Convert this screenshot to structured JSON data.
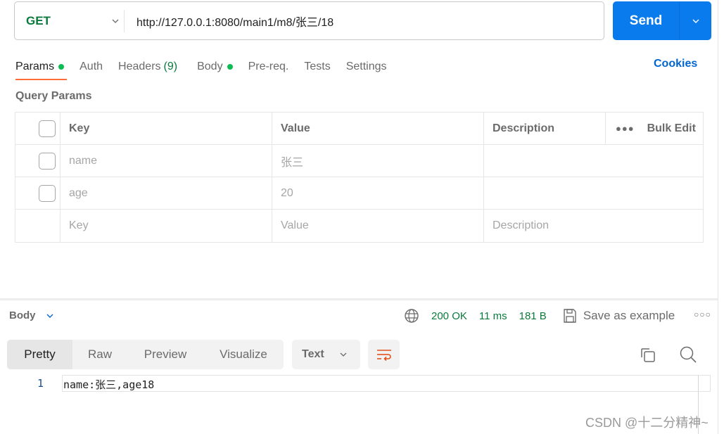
{
  "request": {
    "method": "GET",
    "url": "http://127.0.0.1:8080/main1/m8/张三/18",
    "send_label": "Send"
  },
  "tabs": [
    {
      "label": "Params",
      "dot": true,
      "active": true
    },
    {
      "label": "Auth"
    },
    {
      "label": "Headers",
      "count": "(9)"
    },
    {
      "label": "Body",
      "dot": true
    },
    {
      "label": "Pre-req."
    },
    {
      "label": "Tests"
    },
    {
      "label": "Settings"
    }
  ],
  "cookies_label": "Cookies",
  "query_params": {
    "title": "Query Params",
    "headers": {
      "key": "Key",
      "value": "Value",
      "description": "Description",
      "bulk_edit": "Bulk Edit"
    },
    "rows": [
      {
        "key": "name",
        "value": "张三",
        "description": ""
      },
      {
        "key": "age",
        "value": "20",
        "description": ""
      }
    ],
    "placeholders": {
      "key": "Key",
      "value": "Value",
      "description": "Description"
    }
  },
  "response": {
    "body_label": "Body",
    "status": "200 OK",
    "time": "11 ms",
    "size": "181 B",
    "save_example_label": "Save as example",
    "views": [
      "Pretty",
      "Raw",
      "Preview",
      "Visualize"
    ],
    "active_view": "Pretty",
    "format": "Text",
    "lines": [
      {
        "number": "1",
        "text": "name:张三,age18"
      }
    ]
  },
  "watermark": "CSDN @十二分精神~",
  "colors": {
    "send": "#097bed",
    "method_get": "#0b7a3c",
    "tab_underline": "#ff6c37",
    "status_ok": "#0b7a3c",
    "cookies": "#0265d2",
    "dot": "#0cbb52"
  }
}
